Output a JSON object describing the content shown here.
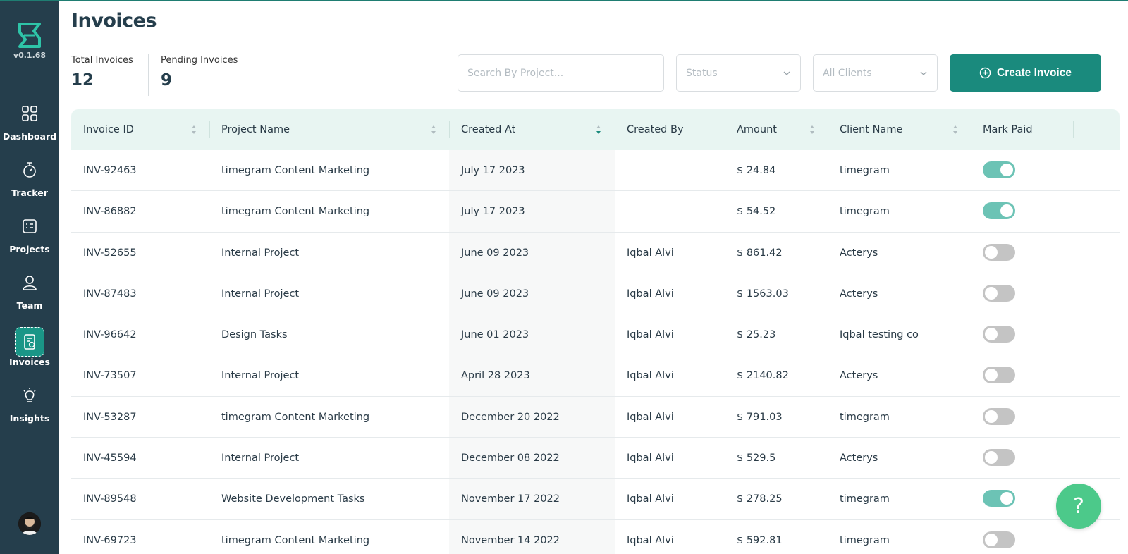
{
  "sidebar": {
    "version": "v0.1.68",
    "items": [
      {
        "label": "Dashboard",
        "icon": "dashboard-icon"
      },
      {
        "label": "Tracker",
        "icon": "stopwatch-icon"
      },
      {
        "label": "Projects",
        "icon": "projects-icon"
      },
      {
        "label": "Team",
        "icon": "user-icon"
      },
      {
        "label": "Invoices",
        "icon": "invoice-icon",
        "active": true
      },
      {
        "label": "Insights",
        "icon": "lightbulb-icon"
      }
    ]
  },
  "header": {
    "title": "Invoices",
    "stats": [
      {
        "label": "Total Invoices",
        "value": "12"
      },
      {
        "label": "Pending Invoices",
        "value": "9"
      }
    ],
    "search_placeholder": "Search By Project...",
    "status_placeholder": "Status",
    "clients_placeholder": "All Clients",
    "create_label": "Create Invoice"
  },
  "table": {
    "columns": [
      "Invoice ID",
      "Project Name",
      "Created At",
      "Created By",
      "Amount",
      "Client Name",
      "Mark Paid"
    ],
    "rows": [
      {
        "id": "INV-92463",
        "project": "timegram Content Marketing",
        "created_at": "July 17 2023",
        "created_by": "",
        "amount": "$ 24.84",
        "client": "timegram",
        "paid": true
      },
      {
        "id": "INV-86882",
        "project": "timegram Content Marketing",
        "created_at": "July 17 2023",
        "created_by": "",
        "amount": "$ 54.52",
        "client": "timegram",
        "paid": true
      },
      {
        "id": "INV-52655",
        "project": "Internal Project",
        "created_at": "June 09 2023",
        "created_by": "Iqbal Alvi",
        "amount": "$ 861.42",
        "client": "Acterys",
        "paid": false
      },
      {
        "id": "INV-87483",
        "project": "Internal Project",
        "created_at": "June 09 2023",
        "created_by": "Iqbal Alvi",
        "amount": "$ 1563.03",
        "client": "Acterys",
        "paid": false
      },
      {
        "id": "INV-96642",
        "project": "Design Tasks",
        "created_at": "June 01 2023",
        "created_by": "Iqbal Alvi",
        "amount": "$ 25.23",
        "client": "Iqbal testing co",
        "paid": false
      },
      {
        "id": "INV-73507",
        "project": "Internal Project",
        "created_at": "April 28 2023",
        "created_by": "Iqbal Alvi",
        "amount": "$ 2140.82",
        "client": "Acterys",
        "paid": false
      },
      {
        "id": "INV-53287",
        "project": "timegram Content Marketing",
        "created_at": "December 20 2022",
        "created_by": "Iqbal Alvi",
        "amount": "$ 791.03",
        "client": "timegram",
        "paid": false
      },
      {
        "id": "INV-45594",
        "project": "Internal Project",
        "created_at": "December 08 2022",
        "created_by": "Iqbal Alvi",
        "amount": "$ 529.5",
        "client": "Acterys",
        "paid": false
      },
      {
        "id": "INV-89548",
        "project": "Website Development Tasks",
        "created_at": "November 17 2022",
        "created_by": "Iqbal Alvi",
        "amount": "$ 278.25",
        "client": "timegram",
        "paid": true
      },
      {
        "id": "INV-69723",
        "project": "timegram Content Marketing",
        "created_at": "November 14 2022",
        "created_by": "Iqbal Alvi",
        "amount": "$ 592.81",
        "client": "timegram",
        "paid": false
      }
    ]
  },
  "help_label": "?",
  "colors": {
    "sidebar": "#253e4c",
    "accent": "#1a8a7d",
    "toggle_on": "#6cc3b5",
    "help": "#4cc98a"
  }
}
